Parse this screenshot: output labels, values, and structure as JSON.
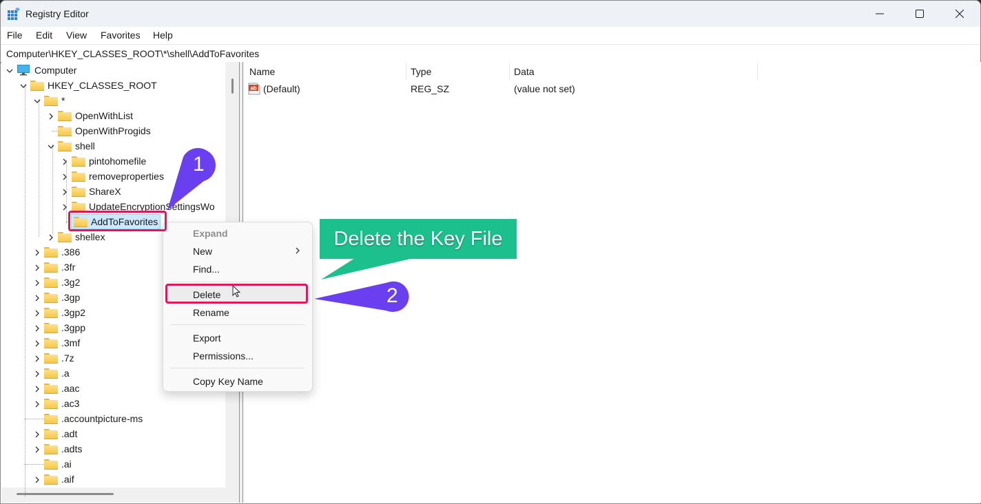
{
  "window": {
    "title": "Registry Editor",
    "controls": [
      "minimize",
      "maximize",
      "close"
    ]
  },
  "menubar": [
    "File",
    "Edit",
    "View",
    "Favorites",
    "Help"
  ],
  "address": "Computer\\HKEY_CLASSES_ROOT\\*\\shell\\AddToFavorites",
  "tree": {
    "root": "Computer",
    "hive": "HKEY_CLASSES_ROOT",
    "star": "*",
    "star_children": [
      "OpenWithList",
      "OpenWithProgids",
      "shell",
      "shellex"
    ],
    "shell_children": [
      "pintohomefile",
      "removeproperties",
      "ShareX",
      "UpdateEncryptionSettingsWo",
      "AddToFavorites"
    ],
    "selected": "AddToFavorites",
    "hive_children": [
      ".386",
      ".3fr",
      ".3g2",
      ".3gp",
      ".3gp2",
      ".3gpp",
      ".3mf",
      ".7z",
      ".a",
      ".aac",
      ".ac3",
      ".accountpicture-ms",
      ".adt",
      ".adts",
      ".ai",
      ".aif"
    ]
  },
  "list": {
    "columns": [
      "Name",
      "Type",
      "Data"
    ],
    "rows": [
      {
        "name": "(Default)",
        "type": "REG_SZ",
        "data": "(value not set)",
        "icon": "string-value-icon"
      }
    ]
  },
  "context_menu": {
    "items": [
      {
        "label": "Expand",
        "disabled": true
      },
      {
        "label": "New",
        "submenu": true
      },
      {
        "label": "Find..."
      },
      {
        "label": "Delete",
        "highlighted": true
      },
      {
        "label": "Rename"
      },
      {
        "label": "Export"
      },
      {
        "label": "Permissions..."
      },
      {
        "label": "Copy Key Name"
      }
    ]
  },
  "annotations": {
    "step1": "1",
    "step2": "2",
    "callout": "Delete the Key File",
    "colors": {
      "step_badge": "#6a3ff0",
      "callout_bg": "#1cc08c",
      "highlight": "#e0185a"
    }
  }
}
